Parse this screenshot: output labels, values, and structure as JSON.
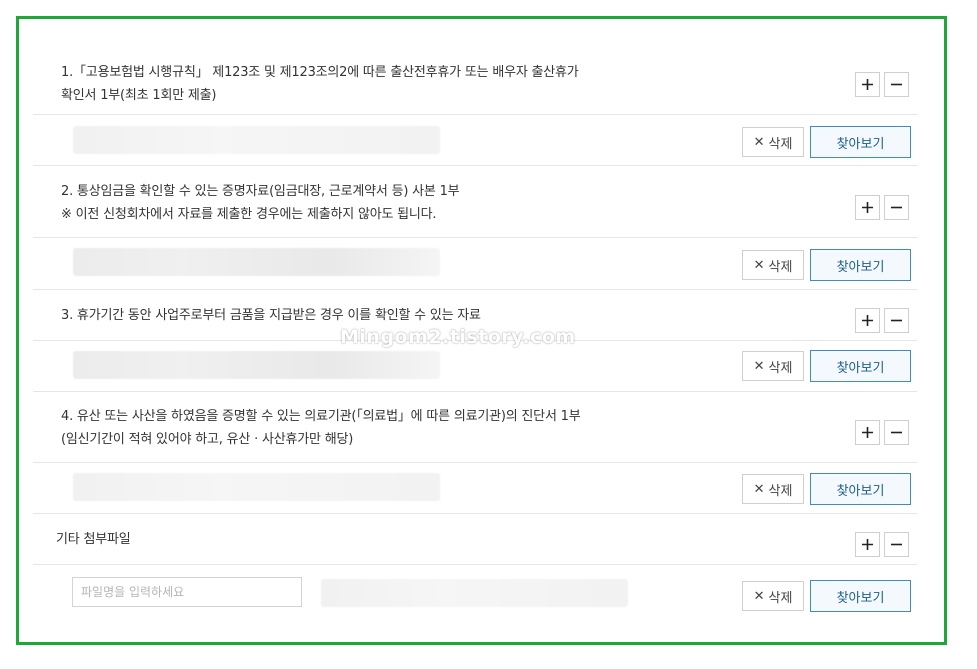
{
  "sections": [
    {
      "line1": "1.「고용보험법 시행규칙」 제123조 및 제123조의2에 따른 출산전후휴가 또는 배우자 출산휴가",
      "line2": "확인서 1부(최초 1회만 제출)"
    },
    {
      "line1": "2. 통상임금을 확인할 수 있는 증명자료(임금대장, 근로계약서 등) 사본 1부",
      "line2": "※ 이전 신청회차에서 자료를 제출한 경우에는 제출하지 않아도 됩니다."
    },
    {
      "line1": "3. 휴가기간 동안 사업주로부터 금품을 지급받은 경우 이를 확인할 수 있는 자료",
      "line2": ""
    },
    {
      "line1": "4. 유산 또는 사산을 하였음을 증명할 수 있는 의료기관(「의료법」에 따른 의료기관)의 진단서 1부",
      "line2": "(임신기간이 적혀 있어야 하고, 유산 · 사산휴가만 해당)"
    }
  ],
  "etc_label": "기타 첨부파일",
  "filename_placeholder": "파일명을 입력하세요",
  "delete_label": "삭제",
  "browse_label": "찾아보기",
  "watermark": "Mingom2.tistory.com",
  "icons": {
    "add": "plus-icon",
    "remove": "minus-icon",
    "delete": "x-icon"
  },
  "colors": {
    "frame": "#1fa83a",
    "browse_border": "#3f8cc2",
    "browse_text": "#1c5d8e"
  }
}
